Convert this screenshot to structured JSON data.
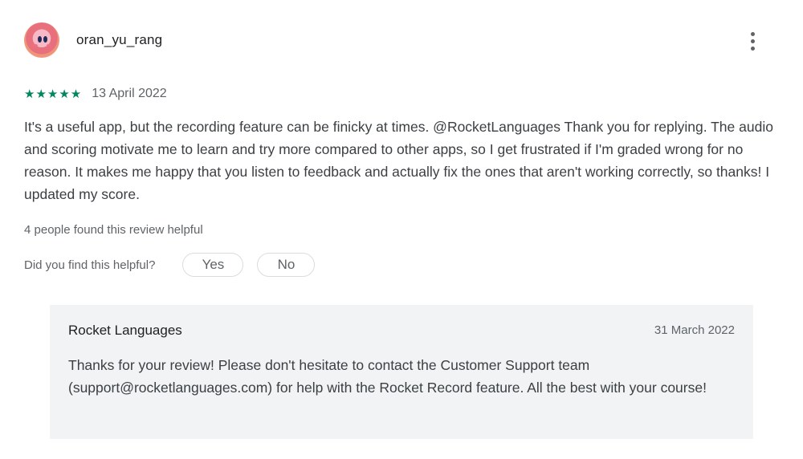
{
  "review": {
    "username": "oran_yu_rang",
    "rating": 5,
    "stars_text": "★★★★★",
    "date": "13 April 2022",
    "text": "It's a useful app, but the recording feature can be finicky at times. @RocketLanguages Thank you for replying. The audio and scoring motivate me to learn and try more compared to other apps, so I get frustrated if I'm graded wrong for no reason. It makes me happy that you listen to feedback and actually fix the ones that aren't working correctly, so thanks! I updated my score.",
    "helpful_count": "4 people found this review helpful",
    "helpful_question": "Did you find this helpful?",
    "yes_label": "Yes",
    "no_label": "No"
  },
  "reply": {
    "author": "Rocket Languages",
    "date": "31 March 2022",
    "text": "Thanks for your review! Please don't hesitate to contact the Customer Support team (support@rocketlanguages.com) for help with the Rocket Record feature. All the best with your course!"
  },
  "icons": {
    "more": "more-vert-icon",
    "star": "star-icon"
  },
  "colors": {
    "star": "#01875f",
    "reply_background": "#f1f3f4",
    "primary_text": "#202124",
    "secondary_text": "#5f6368"
  }
}
